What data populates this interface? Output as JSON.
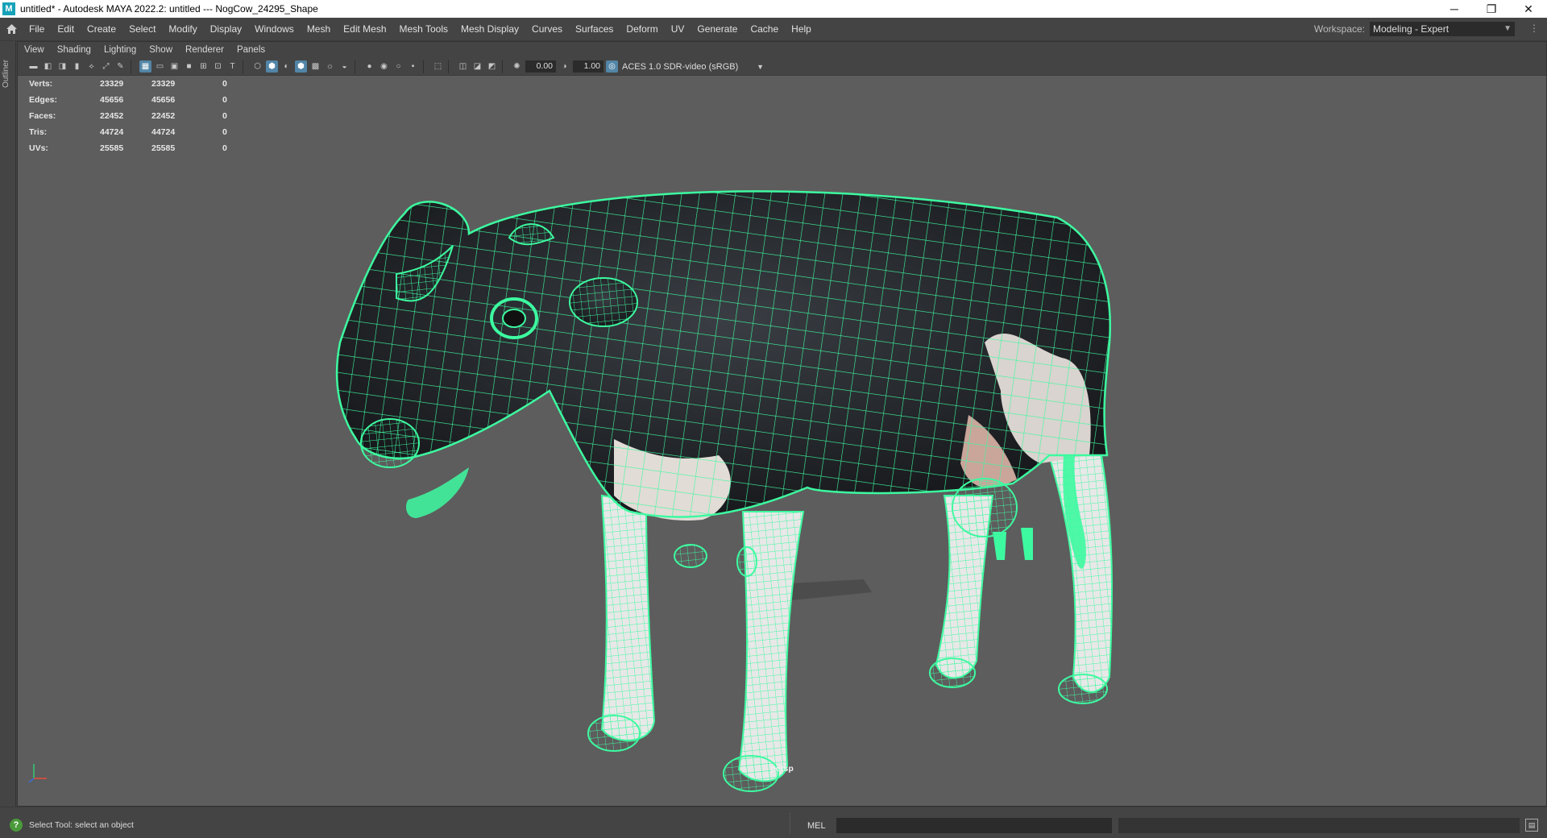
{
  "window": {
    "title": "untitled* - Autodesk MAYA 2022.2: untitled   ---   NogCow_24295_Shape",
    "app_icon": "M",
    "minimize_glyph": "─",
    "restore_glyph": "❐",
    "close_glyph": "✕"
  },
  "menubar": {
    "items": [
      "File",
      "Edit",
      "Create",
      "Select",
      "Modify",
      "Display",
      "Windows",
      "Mesh",
      "Edit Mesh",
      "Mesh Tools",
      "Mesh Display",
      "Curves",
      "Surfaces",
      "Deform",
      "UV",
      "Generate",
      "Cache",
      "Help"
    ],
    "workspace_label": "Workspace:",
    "workspace_value": "Modeling - Expert"
  },
  "left_strip": {
    "outliner_label": "Outliner"
  },
  "panel_menu": {
    "items": [
      "View",
      "Shading",
      "Lighting",
      "Show",
      "Renderer",
      "Panels"
    ]
  },
  "panel_toolbar": {
    "field_1": "0.00",
    "field_2": "1.00",
    "color_space": "ACES 1.0 SDR-video (sRGB)"
  },
  "hud": {
    "rows": [
      {
        "label": "Verts:",
        "v1": "23329",
        "v2": "23329",
        "v3": "0"
      },
      {
        "label": "Edges:",
        "v1": "45656",
        "v2": "45656",
        "v3": "0"
      },
      {
        "label": "Faces:",
        "v1": "22452",
        "v2": "22452",
        "v3": "0"
      },
      {
        "label": "Tris:",
        "v1": "44724",
        "v2": "44724",
        "v3": "0"
      },
      {
        "label": "UVs:",
        "v1": "25585",
        "v2": "25585",
        "v3": "0"
      }
    ]
  },
  "viewport": {
    "camera_label": "persp",
    "wire_color": "#3dfaa0",
    "background_color": "#5d5d5d"
  },
  "statusbar": {
    "help_text": "Select Tool: select an object",
    "mel_label": "MEL"
  }
}
